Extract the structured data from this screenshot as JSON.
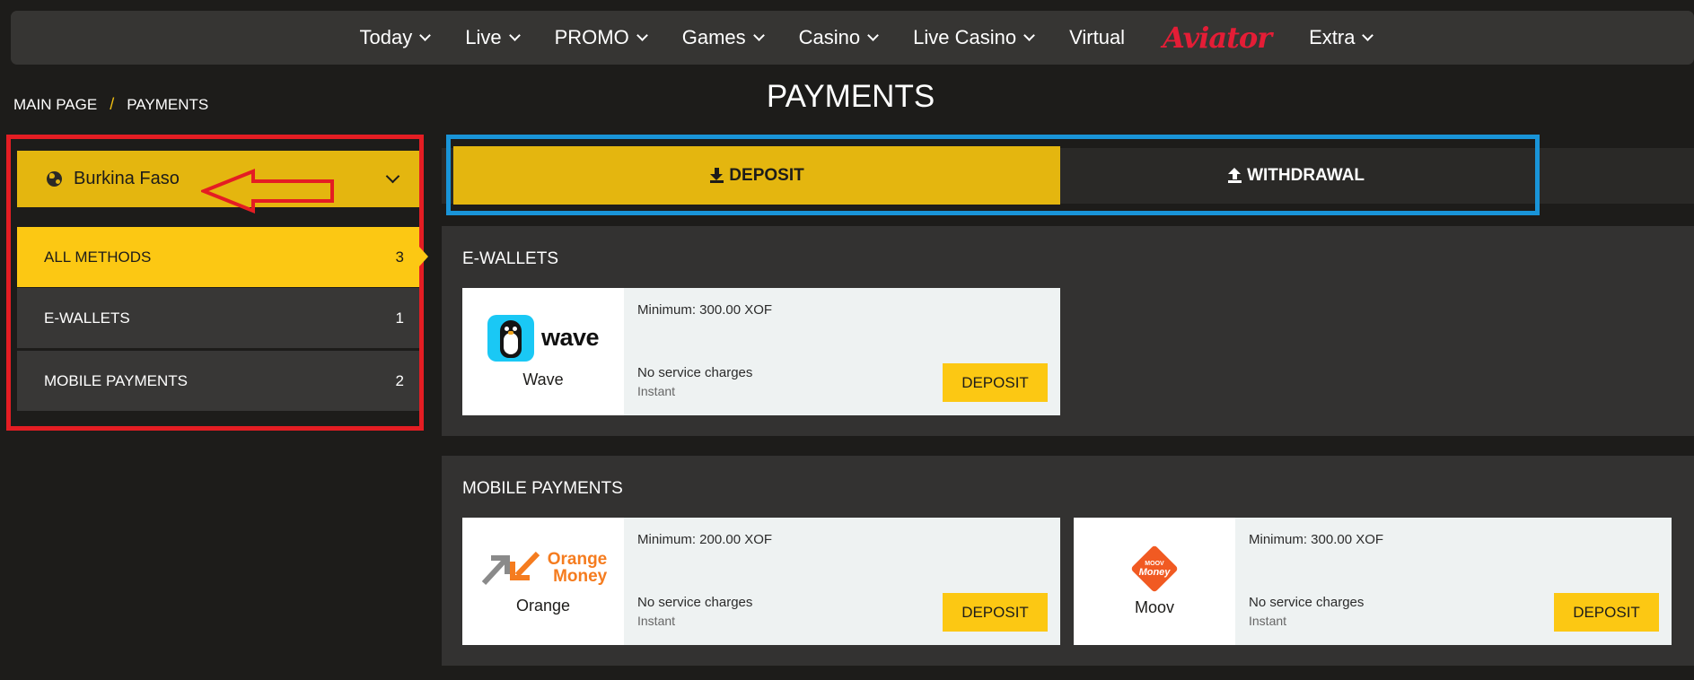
{
  "nav": {
    "items": [
      {
        "label": "Today",
        "dropdown": true
      },
      {
        "label": "Live",
        "dropdown": true
      },
      {
        "label": "PROMO",
        "dropdown": true
      },
      {
        "label": "Games",
        "dropdown": true
      },
      {
        "label": "Casino",
        "dropdown": true
      },
      {
        "label": "Live Casino",
        "dropdown": true
      },
      {
        "label": "Virtual",
        "dropdown": false
      }
    ],
    "logo": "Aviator",
    "extra": "Extra"
  },
  "breadcrumb": {
    "home": "MAIN PAGE",
    "separator": "/",
    "current": "PAYMENTS"
  },
  "page_title": "PAYMENTS",
  "sidebar": {
    "country": "Burkina Faso",
    "methods": [
      {
        "label": "ALL METHODS",
        "count": "3",
        "active": true
      },
      {
        "label": "E-WALLETS",
        "count": "1",
        "active": false
      },
      {
        "label": "MOBILE PAYMENTS",
        "count": "2",
        "active": false
      }
    ]
  },
  "tabs": {
    "deposit": "DEPOSIT",
    "withdrawal": "WITHDRAWAL"
  },
  "sections": {
    "ewallets": {
      "title": "E-WALLETS",
      "cards": [
        {
          "name": "Wave",
          "logo_text": "wave",
          "minimum": "Minimum: 300.00 XOF",
          "charges": "No service charges",
          "speed": "Instant",
          "button": "DEPOSIT"
        }
      ]
    },
    "mobile": {
      "title": "MOBILE PAYMENTS",
      "cards": [
        {
          "name": "Orange",
          "logo_line1": "Orange",
          "logo_line2": "Money",
          "minimum": "Minimum: 200.00 XOF",
          "charges": "No service charges",
          "speed": "Instant",
          "button": "DEPOSIT"
        },
        {
          "name": "Moov",
          "logo_small": "MOOV",
          "logo_big": "Money",
          "minimum": "Minimum: 300.00 XOF",
          "charges": "No service charges",
          "speed": "Instant",
          "button": "DEPOSIT"
        }
      ]
    }
  },
  "colors": {
    "accent": "#fcc813",
    "highlight_red": "#e41d23",
    "highlight_blue": "#1994d8",
    "logo_red": "#e41d36"
  }
}
